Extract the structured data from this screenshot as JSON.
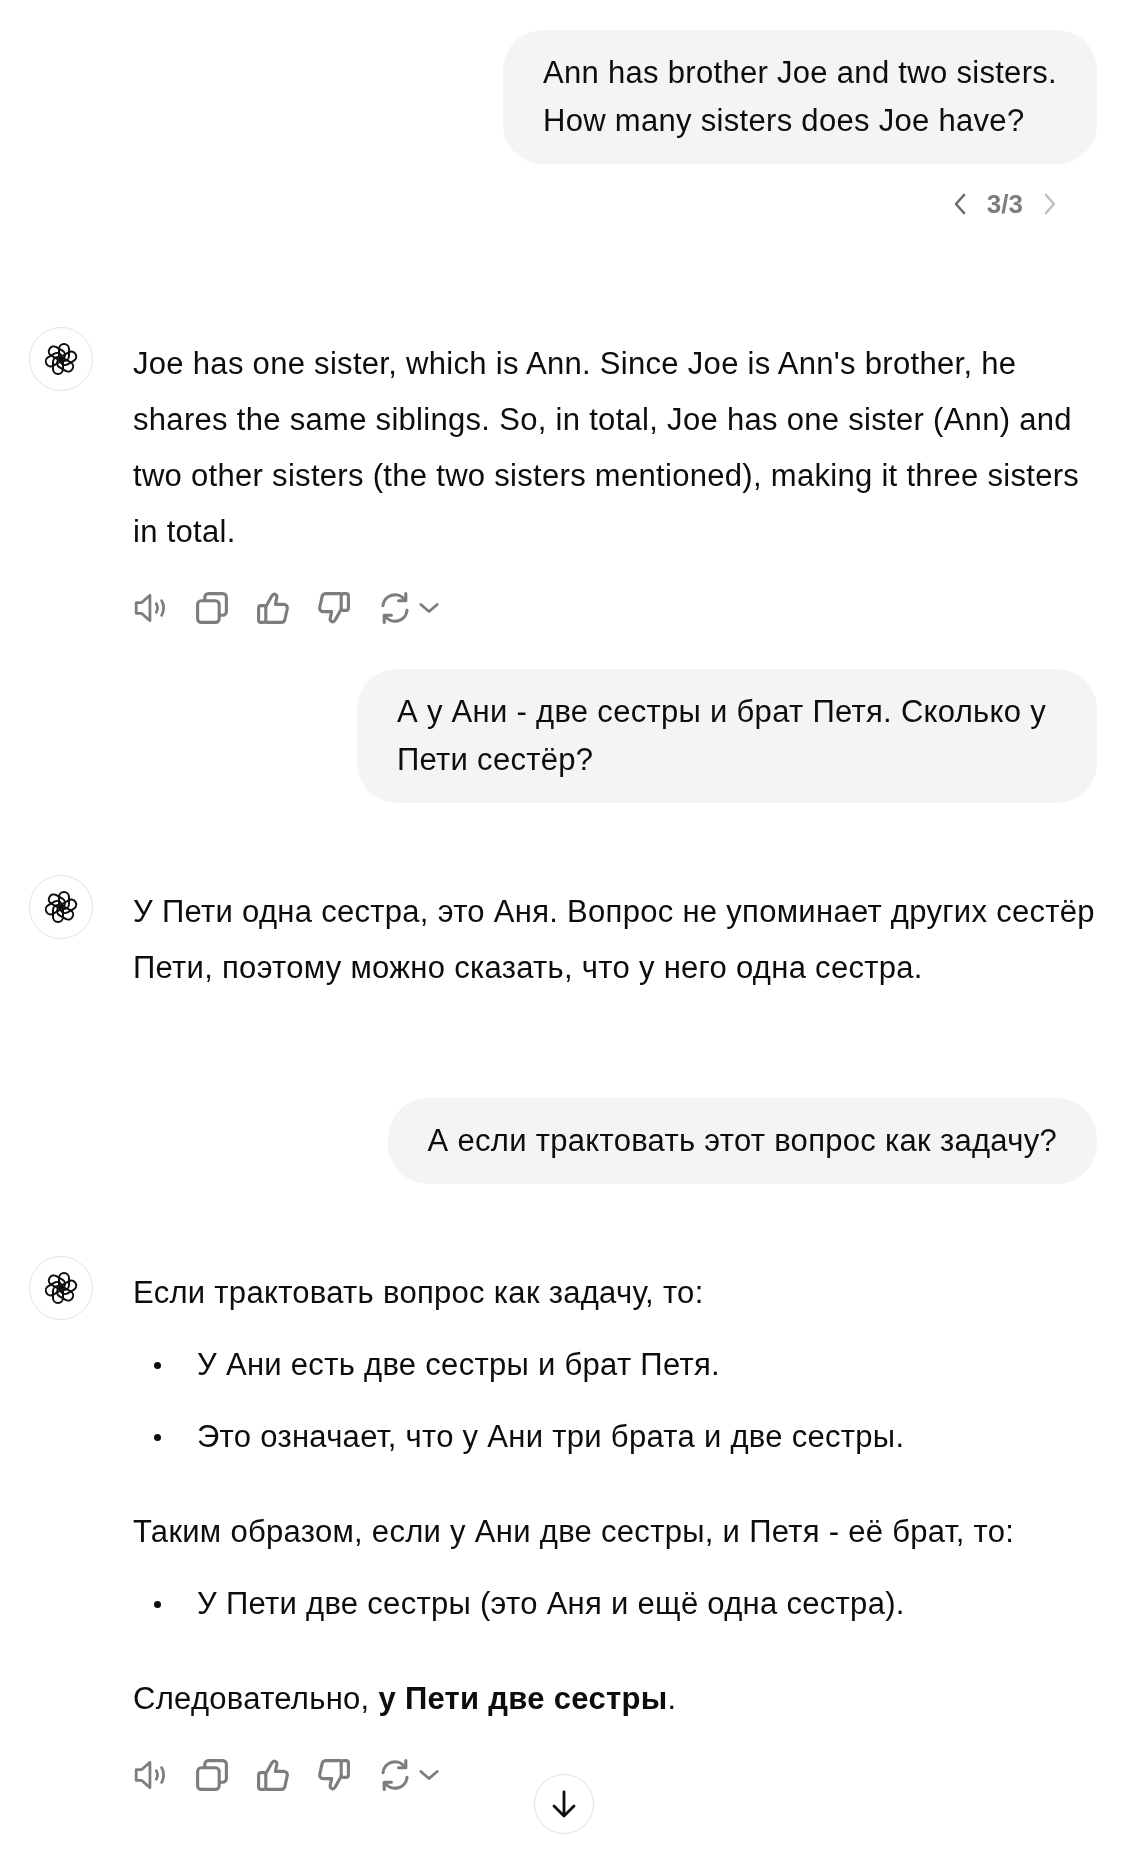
{
  "messages": [
    {
      "kind": "user",
      "text": "Ann has brother Joe and two sisters.\nHow many sisters does Joe have?",
      "pager": {
        "label": "3/3",
        "prev_disabled": false,
        "next_disabled": true
      }
    },
    {
      "kind": "assistant",
      "show_actions": true,
      "blocks": [
        {
          "kind": "paragraph",
          "text": "Joe has one sister, which is Ann. Since Joe is Ann's brother, he shares the same siblings. So, in total, Joe has one sister (Ann) and two other sisters (the two sisters mentioned), making it three sisters in total."
        }
      ]
    },
    {
      "kind": "user",
      "text": "А у Ани - две сестры и брат Петя. Сколько у Пети сестёр?"
    },
    {
      "kind": "assistant",
      "show_actions": false,
      "blocks": [
        {
          "kind": "paragraph",
          "text": "У Пети одна сестра, это Аня. Вопрос не упоминает других сестёр Пети, поэтому можно сказать, что у него одна сестра."
        }
      ]
    },
    {
      "kind": "user",
      "text": "А если трактовать этот вопрос как задачу?"
    },
    {
      "kind": "assistant",
      "show_actions": true,
      "blocks": [
        {
          "kind": "paragraph",
          "text": "Если трактовать вопрос как задачу, то:"
        },
        {
          "kind": "bullet",
          "text": "У Ани есть две сестры и брат Петя."
        },
        {
          "kind": "bullet",
          "text": "Это означает, что у Ани три брата и две сестры."
        },
        {
          "kind": "paragraph",
          "text": "Таким образом, если у Ани две сестры, и Петя - её брат, то:"
        },
        {
          "kind": "bullet",
          "text": "У Пети две сестры (это Аня и ещё одна сестра)."
        },
        {
          "kind": "paragraph",
          "text": "Следовательно, **у Пети две сестры**."
        }
      ]
    }
  ]
}
